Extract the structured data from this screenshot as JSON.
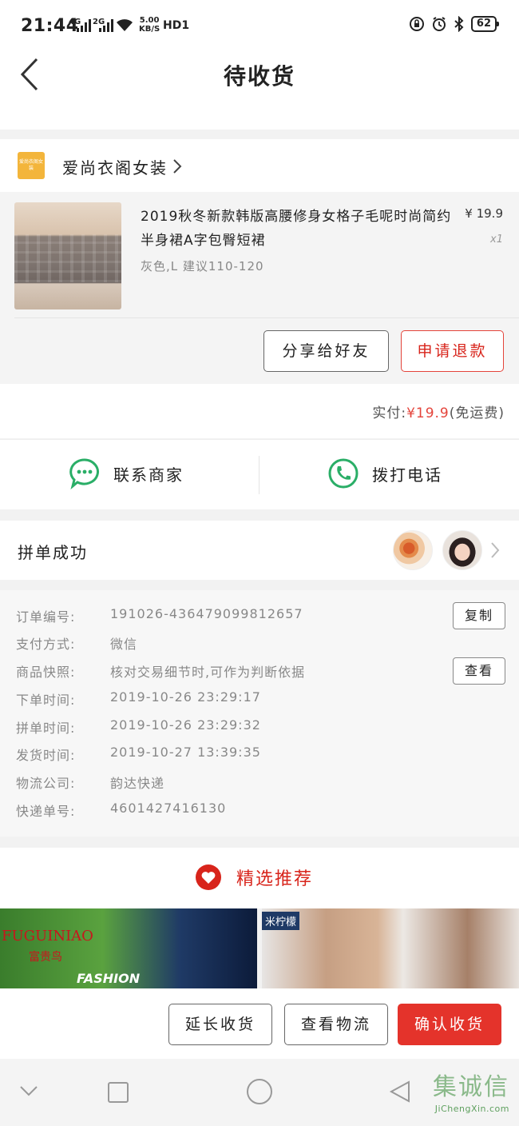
{
  "status_bar": {
    "time": "21:44",
    "net1": "4G",
    "net2": "2G",
    "speed_value": "5.00",
    "speed_unit": "KB/S",
    "hd": "HD1",
    "battery": "62"
  },
  "header": {
    "title": "待收货"
  },
  "shop": {
    "logo_text": "爱尚衣阁女装",
    "name": "爱尚衣阁女装"
  },
  "product": {
    "title": "2019秋冬新款韩版高腰修身女格子毛呢时尚简约半身裙A字包臀短裙",
    "spec": "灰色,L  建议110-120",
    "price": "¥ 19.9",
    "quantity": "x1"
  },
  "product_actions": {
    "share_label": "分享给好友",
    "refund_label": "申请退款"
  },
  "payment": {
    "label": "实付:",
    "amount": "¥19.9",
    "note": "(免运费)"
  },
  "contact": {
    "merchant_label": "联系商家",
    "phone_label": "拨打电话"
  },
  "group": {
    "label": "拼单成功"
  },
  "order_info": {
    "rows": [
      {
        "label": "订单编号:",
        "value": "191026-436479099812657"
      },
      {
        "label": "支付方式:",
        "value": "微信"
      },
      {
        "label": "商品快照:",
        "value": "核对交易细节时,可作为判断依据"
      },
      {
        "label": "下单时间:",
        "value": "2019-10-26  23:29:17"
      },
      {
        "label": "拼单时间:",
        "value": "2019-10-26  23:29:32"
      },
      {
        "label": "发货时间:",
        "value": "2019-10-27  13:39:35"
      },
      {
        "label": "物流公司:",
        "value": "韵达快递"
      },
      {
        "label": "快递单号:",
        "value": "4601427416130"
      }
    ],
    "copy_label": "复制",
    "view_label": "查看"
  },
  "recommend": {
    "title": "精选推荐",
    "items": [
      {
        "brand": "FUGUINIAO",
        "brand_cn": "富贵鸟",
        "text": "FASHION"
      },
      {
        "brand": "米柠檬"
      }
    ]
  },
  "bottom_actions": {
    "extend_label": "延长收货",
    "logistics_label": "查看物流",
    "confirm_label": "确认收货"
  },
  "watermark": {
    "text": "集诚信",
    "url": "JiChengXin.com"
  },
  "colors": {
    "accent_red": "#e4332b",
    "wechat_green": "#2aae67"
  }
}
